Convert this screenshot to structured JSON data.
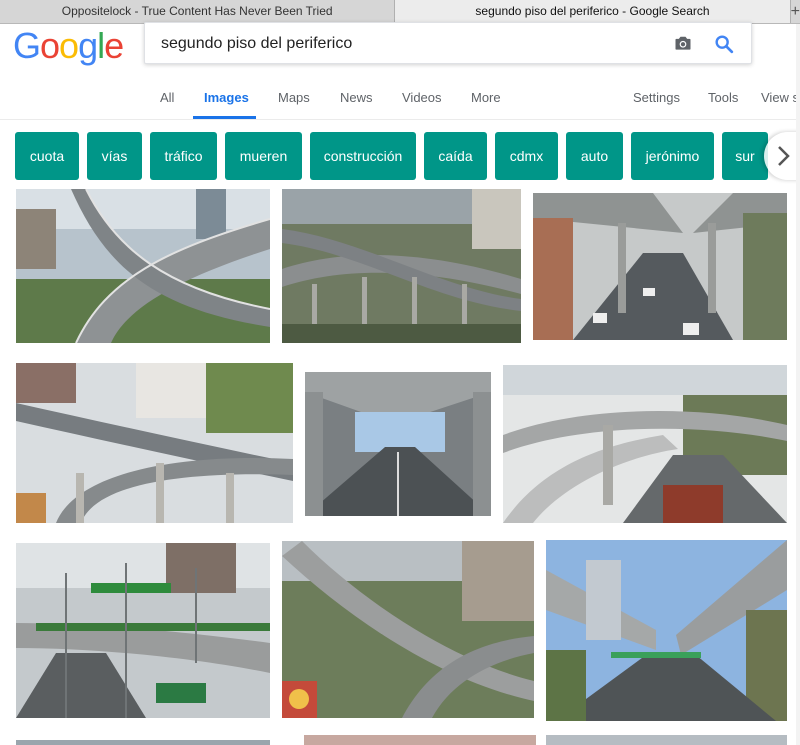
{
  "browser": {
    "tabs": [
      {
        "title": "Oppositelock - True Content Has Never Been Tried"
      },
      {
        "title": "segundo piso del periferico - Google Search"
      }
    ],
    "new_tab_glyph": "+"
  },
  "header": {
    "logo_letters": [
      "G",
      "o",
      "o",
      "g",
      "l",
      "e"
    ],
    "logo_colors": [
      "#4285f4",
      "#ea4335",
      "#fbbc05",
      "#4285f4",
      "#34a853",
      "#ea4335"
    ],
    "search_value": "segundo piso del periferico"
  },
  "nav": {
    "all": "All",
    "images": "Images",
    "maps": "Maps",
    "news": "News",
    "videos": "Videos",
    "more": "More",
    "settings": "Settings",
    "tools": "Tools",
    "view_saved": "View s"
  },
  "chips": [
    "cuota",
    "vías",
    "tráfico",
    "mueren",
    "construcción",
    "caída",
    "cdmx",
    "auto",
    "jerónimo",
    "sur"
  ],
  "colors": {
    "accent": "#1a73e8",
    "chip": "#009688"
  },
  "icons": {
    "camera": "camera-icon",
    "search": "search-icon",
    "chip_next": "chevron-right-icon"
  },
  "results": [
    {
      "name": "result-image-1"
    },
    {
      "name": "result-image-2"
    },
    {
      "name": "result-image-3"
    },
    {
      "name": "result-image-4"
    },
    {
      "name": "result-image-5"
    },
    {
      "name": "result-image-6"
    },
    {
      "name": "result-image-7"
    },
    {
      "name": "result-image-8"
    },
    {
      "name": "result-image-9"
    }
  ]
}
